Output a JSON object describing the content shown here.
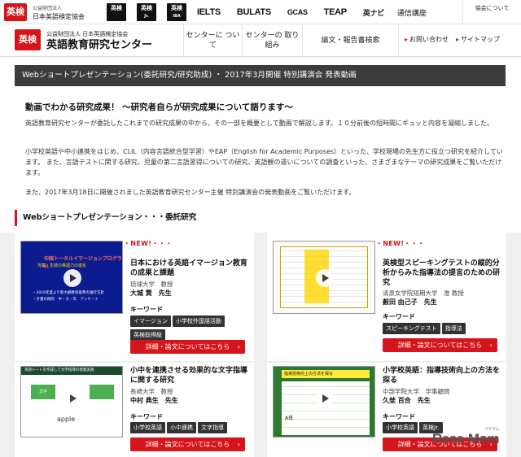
{
  "top_bar": {
    "logo_text": "英検",
    "assoc_line1": "公益財団法人",
    "assoc_line2": "日本英語検定協会",
    "brands": {
      "eiken": "英検",
      "eiken_jr": "英検",
      "eiken_jr_sub": "Jr.",
      "eiken_iba": "英検",
      "eiken_iba_sub": "IBA",
      "ielts": "IELTS",
      "bulats": "BULATS",
      "gcas": "GCAS",
      "teap": "TEAP",
      "eitenavi": "英ナビ",
      "tsushin": "通信講座"
    },
    "assoc_link": "協会について"
  },
  "nav": {
    "logo_text": "英検",
    "center_line1": "公益財団法人 日本英語検定協会",
    "center_line2": "英語教育研究センター",
    "items": {
      "about": "センターに ついて",
      "efforts": "センターの 取り組み",
      "papers": "論文・報告書検索",
      "contact": "お問い合わせ",
      "sitemap": "サイトマップ"
    }
  },
  "title_band": "Webショートプレゼンテーション(委託研究/研究助成) ・ 2017年3月開催 特別講演会 発表動画",
  "intro": {
    "heading": "動画でわかる研究成果！ ～研究者自らが研究成果について語ります～",
    "para1": "英語教育研究センターが委託したこれまでの研究成果の中から、その一部を概要として動画で解説します。１０分前後の短時間にギュッと内容を凝縮しました。",
    "para2": "小学校英語や中小連携をはじめ、CLIL（内容言語統合型学習）やEAP（English for Academic Purposes）といった、学校現場の先生方に役立つ研究を紹介しています。 また、言語テストに関する研究、児童の第二言語習得についての研究、英語観の違いについての調査といった、さまざまなテーマの研究成果をご覧いただけます。",
    "para3": "また、2017年3月18日に開催されました英語教育研究センター主催 特別講演会の発表動画をご覧いただけます。"
  },
  "section_heading": "Webショートプレゼンテーション・・・委託研究",
  "cards": [
    {
      "new_label": "・・・NEW!・・・",
      "title": "日本における英語イマージョン教育の成果と課題",
      "affiliation": "琉球大学　教授",
      "name": "大城 賢　先生",
      "keyword_label": "キーワード",
      "tags": [
        "イマージョン",
        "小学校外国語活動",
        "英検取得級"
      ],
      "button": "詳細・論文についてはこちら",
      "thumb_lines": [
        "中国ト一タルイマージョンプログラム",
        "児童・生徒の英語力の進化",
        "・2016年度より新大綱教育基準の施行方針",
        "・計量の傾向　中・大・年　アンケート"
      ]
    },
    {
      "new_label": "・・・NEW!・・・",
      "title": "英検型スピーキングテストの縦的分析からみた指導法の提言のための研究",
      "affiliation": "清泉女学院短期大学　准 教授",
      "name": "薮田 由己子　先生",
      "keyword_label": "キーワード",
      "tags": [
        "スピーキングテスト",
        "指導法"
      ],
      "button": "詳細・論文についてはこちら"
    },
    {
      "title": "小中を連携させる効果的な文字指導に関する研究",
      "affiliation": "長崎大学　教授",
      "name": "中村 典生　先生",
      "keyword_label": "キーワード",
      "tags": [
        "小学校英語",
        "小中連携",
        "文字指導"
      ],
      "button": "詳細・論文についてはこちら",
      "thumb_bar": "英語シートを作成して文字指導の授業実践",
      "thumb_box": "文字",
      "thumb_word": "apple"
    },
    {
      "title": "小学校英語：指導技術向上の方法を探る",
      "affiliation": "中部学院大学　学事顧問",
      "name": "久埜 百合　先生",
      "keyword_label": "キーワード",
      "tags": [
        "小学校英語",
        "英検Jr."
      ],
      "button": "詳細・論文についてはこちら",
      "thumb_header": "指導技術向上の方法を探る",
      "thumb_score": "A班"
    }
  ],
  "watermark": {
    "text_a": "Rese",
    "text_b": "Mom",
    "small": "リセマム"
  },
  "colors": {
    "accent": "#d6141c",
    "dark_band": "#3c3c3c",
    "tag_bg": "#333333",
    "section_bg": "#efefef"
  }
}
